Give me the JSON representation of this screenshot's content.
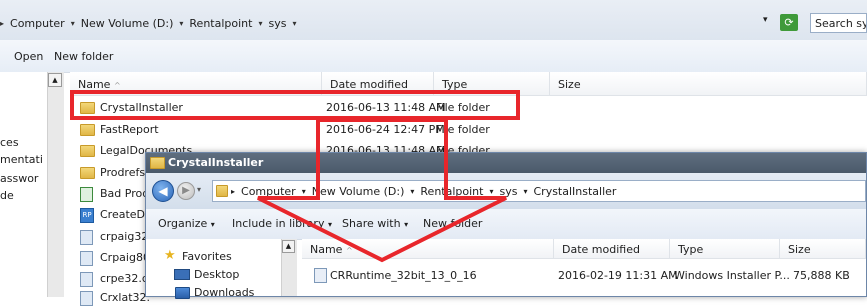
{
  "back_window": {
    "breadcrumb": [
      "Computer",
      "New Volume (D:)",
      "Rentalpoint",
      "sys"
    ],
    "search_placeholder": "Search sys",
    "toolbar": {
      "open": "Open",
      "new_folder": "New folder"
    },
    "left_pane_items": [
      "ces",
      "mentati",
      "asswor",
      "de"
    ],
    "columns": {
      "name": "Name",
      "date": "Date modified",
      "type": "Type",
      "size": "Size"
    },
    "rows": [
      {
        "name": "CrystalInstaller",
        "date": "2016-06-13 11:48 AM",
        "type": "File folder",
        "icon": "folder-icon"
      },
      {
        "name": "FastReport",
        "date": "2016-06-24 12:47 PM",
        "type": "File folder",
        "icon": "folder-icon"
      },
      {
        "name": "LegalDocuments",
        "date": "2016-06-13 11:48 AM",
        "type": "File folder",
        "icon": "folder-icon"
      },
      {
        "name": "Prodrefs",
        "icon": "folder-icon"
      },
      {
        "name": "Bad Prod",
        "icon": "spreadsheet-icon"
      },
      {
        "name": "CreateDa",
        "icon": "rp-app-icon"
      },
      {
        "name": "crpaig32.",
        "icon": "dll-icon"
      },
      {
        "name": "Crpaig80",
        "icon": "dll-icon"
      },
      {
        "name": "crpe32.dl",
        "icon": "dll-icon"
      },
      {
        "name": "Crxlat32.",
        "icon": "dll-icon"
      }
    ]
  },
  "front_window": {
    "title": "CrystalInstaller",
    "breadcrumb": [
      "Computer",
      "New Volume (D:)",
      "Rentalpoint",
      "sys",
      "CrystalInstaller"
    ],
    "toolbar": {
      "organize": "Organize",
      "include_in_library": "Include in library",
      "share_with": "Share with",
      "new_folder": "New folder"
    },
    "nav_items": [
      "Favorites",
      "Desktop",
      "Downloads"
    ],
    "columns": {
      "name": "Name",
      "date": "Date modified",
      "type": "Type",
      "size": "Size"
    },
    "files": [
      {
        "name": "CRRuntime_32bit_13_0_16",
        "date": "2016-02-19 11:31 AM",
        "type": "Windows Installer P...",
        "size": "75,888 KB"
      }
    ]
  },
  "colors": {
    "highlight": "#e8262b",
    "accent": "#2a66b8"
  }
}
